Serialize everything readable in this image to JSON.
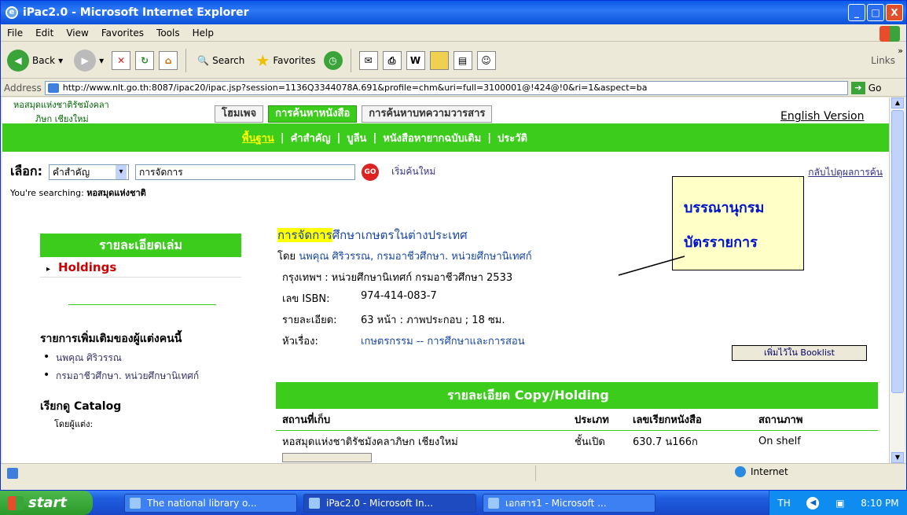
{
  "window": {
    "title": "iPac2.0 - Microsoft Internet Explorer",
    "minimize": "_",
    "maximize": "□",
    "close": "X"
  },
  "menu": [
    "File",
    "Edit",
    "View",
    "Favorites",
    "Tools",
    "Help"
  ],
  "toolbar": {
    "back": "Back",
    "search": "Search",
    "favorites": "Favorites",
    "links": "Links",
    "overflow": "»"
  },
  "address": {
    "label": "Address",
    "url": "http://www.nlt.go.th:8087/ipac20/ipac.jsp?session=1136Q3344078A.691&profile=chm&uri=full=3100001@!424@!0&ri=1&aspect=ba",
    "go": "Go"
  },
  "site": {
    "library_name_1": "หอสมุดแห่งชาติรัชมังคลา",
    "library_name_2": "ภิษก เชียงใหม่",
    "tabs": [
      "โฮมเพจ",
      "การค้นหาหนังสือ",
      "การค้นหาบทความวารสาร"
    ],
    "english": "English Version",
    "subnav": [
      "พื้นฐาน",
      "คำสำคัญ",
      "บูลีน",
      "หนังสือหายากฉบับเดิม",
      "ประวัติ"
    ],
    "subnav_sep": "|",
    "search": {
      "label": "เลือก:",
      "type": "คำสำคัญ",
      "query": "การจัดการ",
      "go": "GO",
      "new": "เริ่มค้นใหม่",
      "back": "กลับไปดูผลการค้น"
    },
    "searching_label": "You're searching:",
    "searching_value": "หอสมุดแห่งชาติ"
  },
  "left": {
    "head": "รายละเอียดเล่ม",
    "holdings": "Holdings",
    "more_by": "รายการเพิ่มเติมของผู้แต่งคนนี้",
    "authors": [
      "นพคุณ ศิริวรรณ",
      "กรมอาชีวศึกษา. หน่วยศึกษานิเทศก์"
    ],
    "browse": "เรียกดู Catalog",
    "by_author": "โดยผู้แต่ง:"
  },
  "record": {
    "title_hl": "การจัดการ",
    "title_rest": "ศึกษาเกษตรในต่างประเทศ",
    "author_prefix": "โดย",
    "author": "นพคุณ ศิริวรรณ, กรมอาชีวศึกษา. หน่วยศึกษานิเทศก์",
    "publisher": "กรุงเทพฯ : หน่วยศึกษานิเทศก์ กรมอาชีวศึกษา 2533",
    "isbn_k": "เลข ISBN:",
    "isbn_v": "974-414-083-7",
    "desc_k": "รายละเอียด:",
    "desc_v": "63 หน้า : ภาพประกอบ ; 18 ซม.",
    "subj_k": "หัวเรื่อง:",
    "subj_v": "เกษตรกรรม -- การศึกษาและการสอน",
    "booklist": "เพิ่มไว้ใน Booklist"
  },
  "callout": {
    "line1": "บรรณานุกรม",
    "line2": "บัตรรายการ"
  },
  "copy": {
    "head": "รายละเอียด Copy/Holding",
    "cols": [
      "สถานที่เก็บ",
      "ประเภท",
      "เลขเรียกหนังสือ",
      "สถานภาพ"
    ],
    "rows": [
      [
        "หอสมุดแห่งชาติรัชมังคลาภิษก เชียงใหม่",
        "ชั้นเปิด",
        "630.7 น166ก",
        "On shelf"
      ]
    ]
  },
  "status": {
    "zone": "Internet"
  },
  "taskbar": {
    "start": "start",
    "tasks": [
      "The national library o...",
      "iPac2.0 - Microsoft In...",
      "เอกสาร1 - Microsoft ..."
    ],
    "lang": "TH",
    "time": "8:10 PM"
  }
}
